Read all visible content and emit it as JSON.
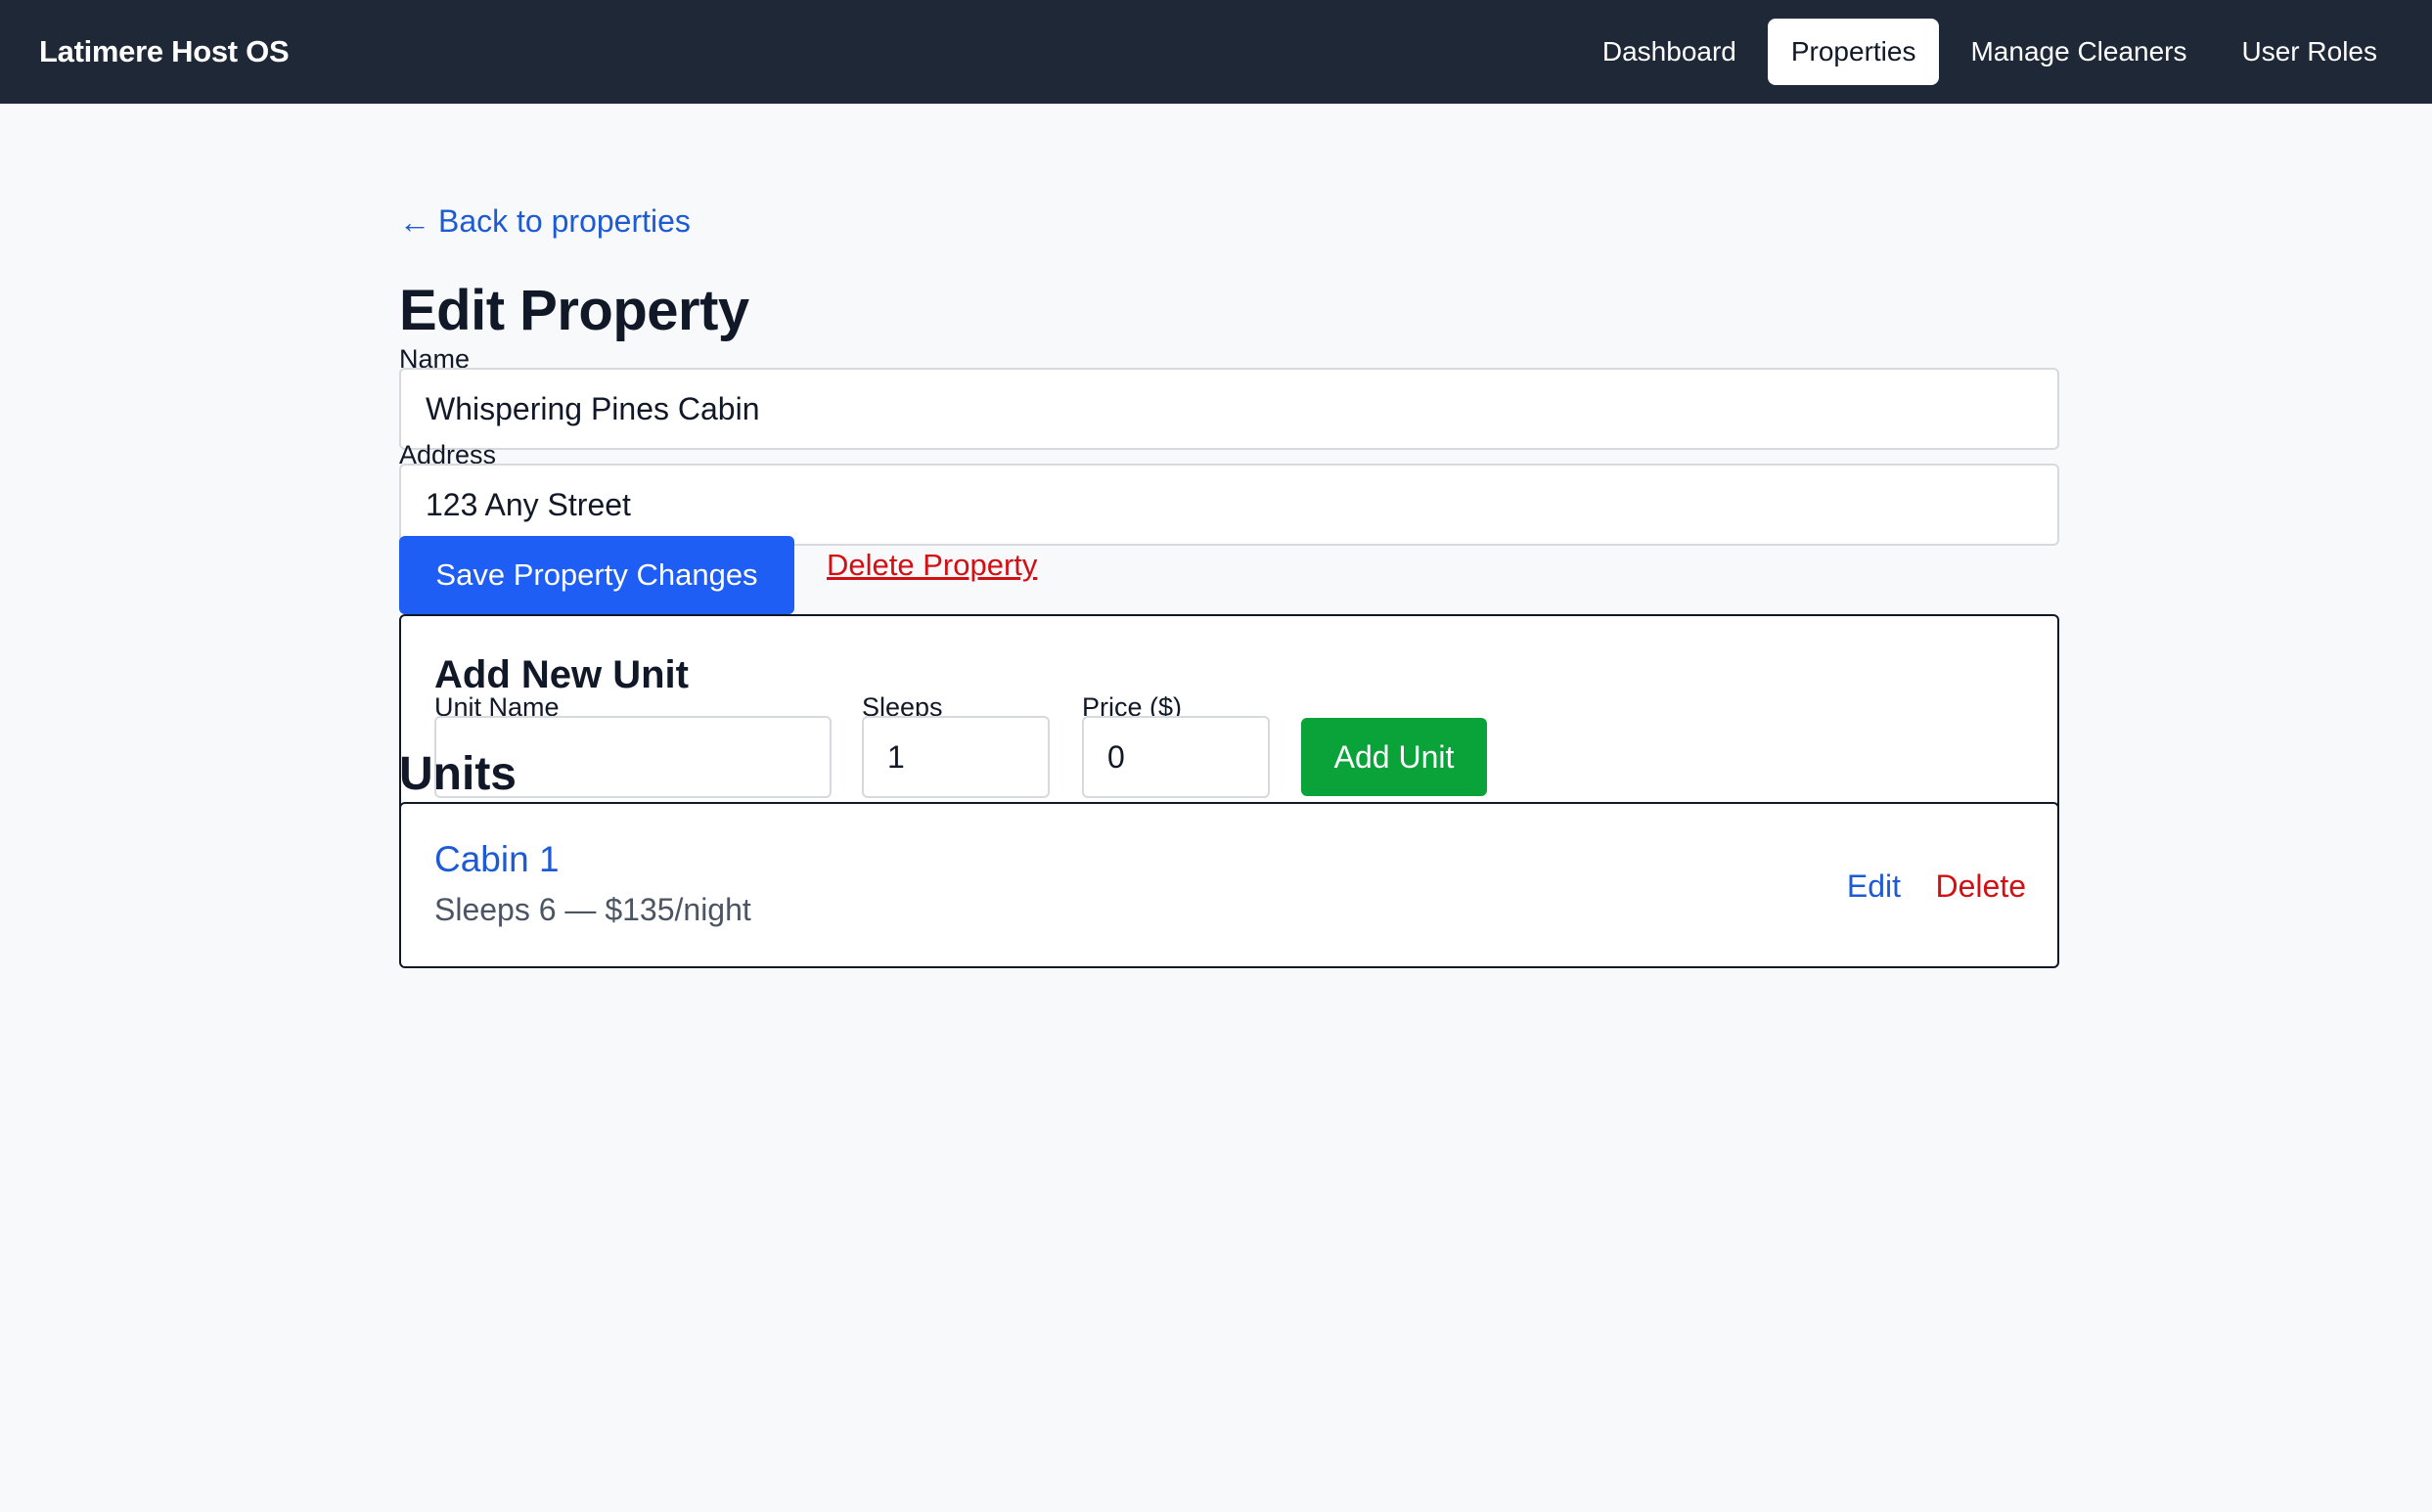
{
  "app": {
    "brand": "Latimere Host OS"
  },
  "nav": {
    "items": [
      {
        "label": "Dashboard",
        "active": false
      },
      {
        "label": "Properties",
        "active": true
      },
      {
        "label": "Manage Cleaners",
        "active": false
      },
      {
        "label": "User Roles",
        "active": false
      }
    ]
  },
  "page": {
    "back_arrow": "←",
    "back_label": "Back to properties",
    "title": "Edit Property"
  },
  "form": {
    "name_label": "Name",
    "name_value": "Whispering Pines Cabin",
    "address_label": "Address",
    "address_value": "123 Any Street",
    "save_label": "Save Property Changes",
    "delete_label": "Delete Property"
  },
  "add_unit": {
    "title": "Add New Unit",
    "unit_name_label": "Unit Name",
    "unit_name_value": "",
    "sleeps_label": "Sleeps",
    "sleeps_value": "1",
    "price_label": "Price ($)",
    "price_value": "0",
    "button_label": "Add Unit"
  },
  "units": {
    "heading": "Units",
    "items": [
      {
        "name": "Cabin 1",
        "details": "Sleeps 6 — $135/night",
        "edit_label": "Edit",
        "delete_label": "Delete"
      }
    ]
  },
  "colors": {
    "topbar": "#1e2836",
    "primary": "#1e5ef5",
    "link": "#1d5bd6",
    "danger": "#d40f14",
    "success": "#0aa33a"
  }
}
